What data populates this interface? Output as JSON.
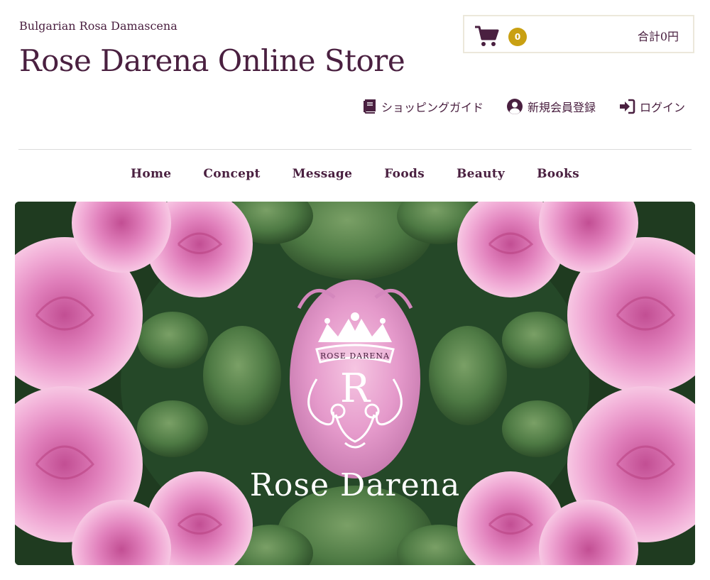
{
  "header": {
    "tagline": "Bulgarian Rosa Damascena",
    "title": "Rose Darena Online Store"
  },
  "cart": {
    "icon": "cart-icon",
    "count": "0",
    "total": "合計0円",
    "badge_color": "#c9a012"
  },
  "util_nav": {
    "guide": {
      "label": "ショッピングガイド",
      "icon": "book-icon"
    },
    "register": {
      "label": "新規会員登録",
      "icon": "user-circle-icon"
    },
    "login": {
      "label": "ログイン",
      "icon": "sign-in-icon"
    }
  },
  "main_nav": {
    "items": [
      "Home",
      "Concept",
      "Message",
      "Foods",
      "Beauty",
      "Books"
    ]
  },
  "hero": {
    "logo_text": "ROSE DARENA",
    "brand_text": "Rose Darena",
    "monogram": "R"
  },
  "colors": {
    "brand": "#4a2040",
    "rose_pink": "#e89ac8",
    "leaf_green": "#4e7a44",
    "cart_border": "#ece8db"
  }
}
